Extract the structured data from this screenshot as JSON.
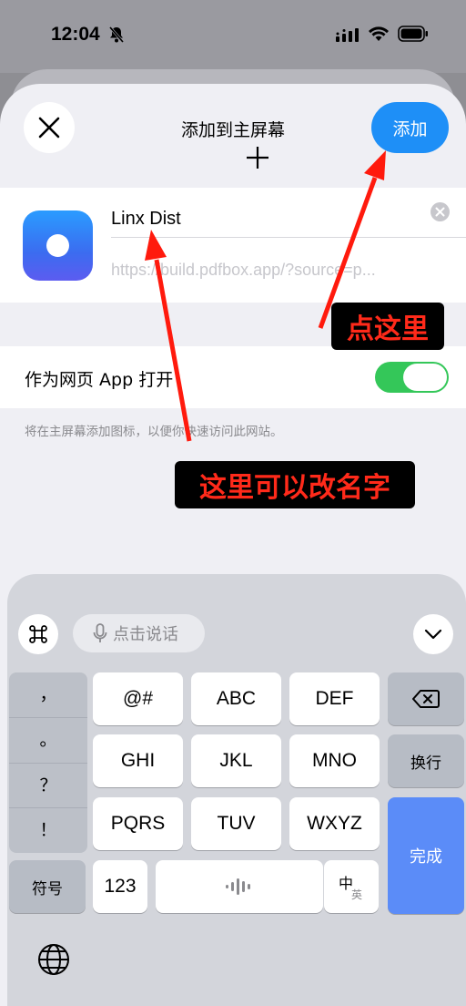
{
  "status": {
    "time": "12:04"
  },
  "header": {
    "title": "添加到主屏幕",
    "add_label": "添加"
  },
  "app": {
    "name": "Linx Dist",
    "url": "https://build.pdfbox.app/?source=p..."
  },
  "toggle": {
    "label": "作为网页 App 打开",
    "on": true
  },
  "hint": "将在主屏幕添加图标，以便你快速访问此网站。",
  "annotations": {
    "tap_here": "点这里",
    "rename_here": "这里可以改名字",
    "arrow_color": "#ff1a0d"
  },
  "keyboard": {
    "voice_label": "点击说话",
    "punct": [
      "，",
      "。",
      "？",
      "！"
    ],
    "row1": [
      "@#",
      "ABC",
      "DEF"
    ],
    "row2": [
      "GHI",
      "JKL",
      "MNO"
    ],
    "row3": [
      "PQRS",
      "TUV",
      "WXYZ"
    ],
    "symbols": "符号",
    "numbers": "123",
    "newline": "换行",
    "done": "完成",
    "lang_top": "中",
    "lang_bottom": "英"
  },
  "colors": {
    "accent": "#1e8ff7",
    "toggle_on": "#34c759",
    "done_key": "#5b8cf8"
  }
}
